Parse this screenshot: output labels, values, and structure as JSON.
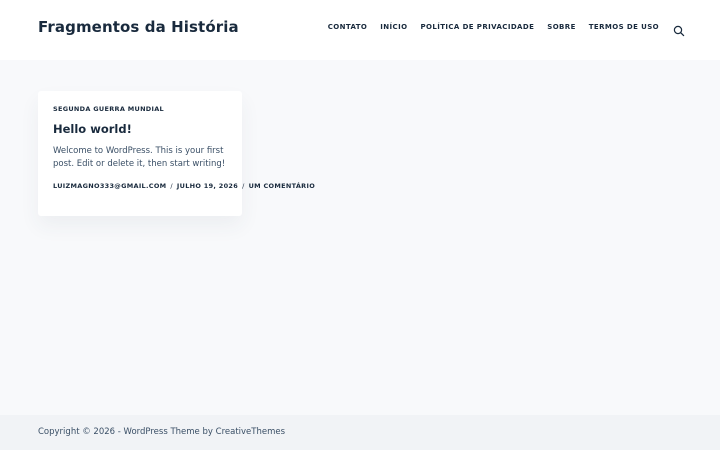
{
  "header": {
    "site_title": "Fragmentos da História",
    "nav": [
      {
        "label": "CONTATO"
      },
      {
        "label": "INÍCIO"
      },
      {
        "label": "POLÍTICA DE PRIVACIDADE"
      },
      {
        "label": "SOBRE"
      },
      {
        "label": "TERMOS DE USO"
      }
    ],
    "search_icon": "search-icon"
  },
  "post": {
    "category": "SEGUNDA GUERRA MUNDIAL",
    "title": "Hello world!",
    "excerpt": "Welcome to WordPress. This is your first post. Edit or delete it, then start writing!",
    "meta": {
      "author": "LUIZMAGNO333@GMAIL.COM",
      "separator": "/",
      "date": "JULHO 19, 2026",
      "comments": "UM COMENTÁRIO"
    }
  },
  "footer": {
    "copyright_prefix": "Copyright © 2026 - ",
    "theme_link": "WordPress Theme",
    "by_text": " by ",
    "author_link": "CreativeThemes"
  },
  "colors": {
    "heading": "#192a3d",
    "text": "#3a4f66",
    "page_background": "#f8f9fb",
    "footer_background": "#f1f3f6"
  }
}
